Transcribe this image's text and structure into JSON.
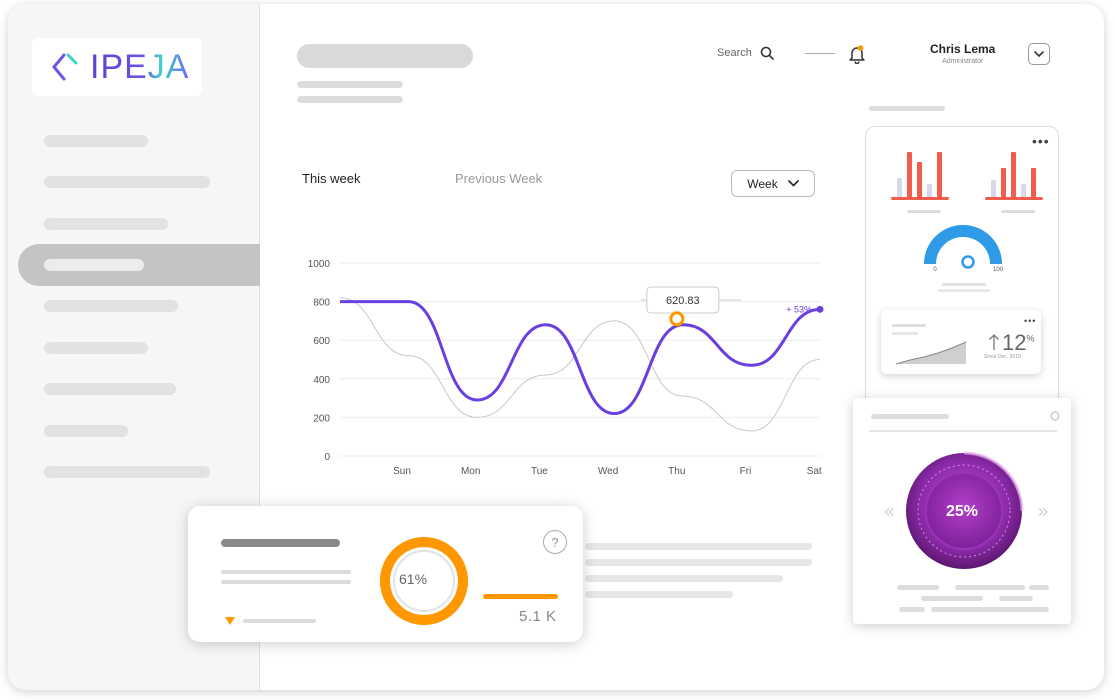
{
  "brand": {
    "name": "IPEJA"
  },
  "header": {
    "search_label": "Search",
    "user_name": "Chris Lema",
    "user_role": "Administrator"
  },
  "tabs": [
    {
      "label": "This week",
      "active": true
    },
    {
      "label": "Previous Week",
      "active": false
    }
  ],
  "period_select": {
    "value": "Week"
  },
  "chart_data": {
    "type": "line",
    "categories": [
      "Sun",
      "Mon",
      "Tue",
      "Wed",
      "Thu",
      "Fri",
      "Sat"
    ],
    "y_ticks": [
      "1000",
      "800",
      "600",
      "400",
      "200",
      "0"
    ],
    "ylim": [
      0,
      1000
    ],
    "series": [
      {
        "color": "#6a3fe0",
        "values": [
          800,
          800,
          290,
          680,
          220,
          680,
          470,
          760
        ]
      },
      {
        "color": "#c8c8c8",
        "values": [
          820,
          520,
          200,
          420,
          700,
          310,
          130,
          500
        ]
      }
    ],
    "tooltip": {
      "value": "620.83"
    },
    "change_label": "+ 53%"
  },
  "gauge": {
    "min": "0",
    "max": "100"
  },
  "mini_stat": {
    "value": "12",
    "unit": "%",
    "since": "Since Dec. 2010"
  },
  "knob": {
    "value": "25%"
  },
  "summary_card": {
    "percent": "61%",
    "percent_value": 61,
    "help": "?",
    "value": "5.1 K"
  },
  "colors": {
    "accent": "#6a3fe0",
    "orange": "#ff9800",
    "red": "#f25c4c",
    "blue": "#2f9ae8",
    "purple": "#8b2aa8"
  }
}
